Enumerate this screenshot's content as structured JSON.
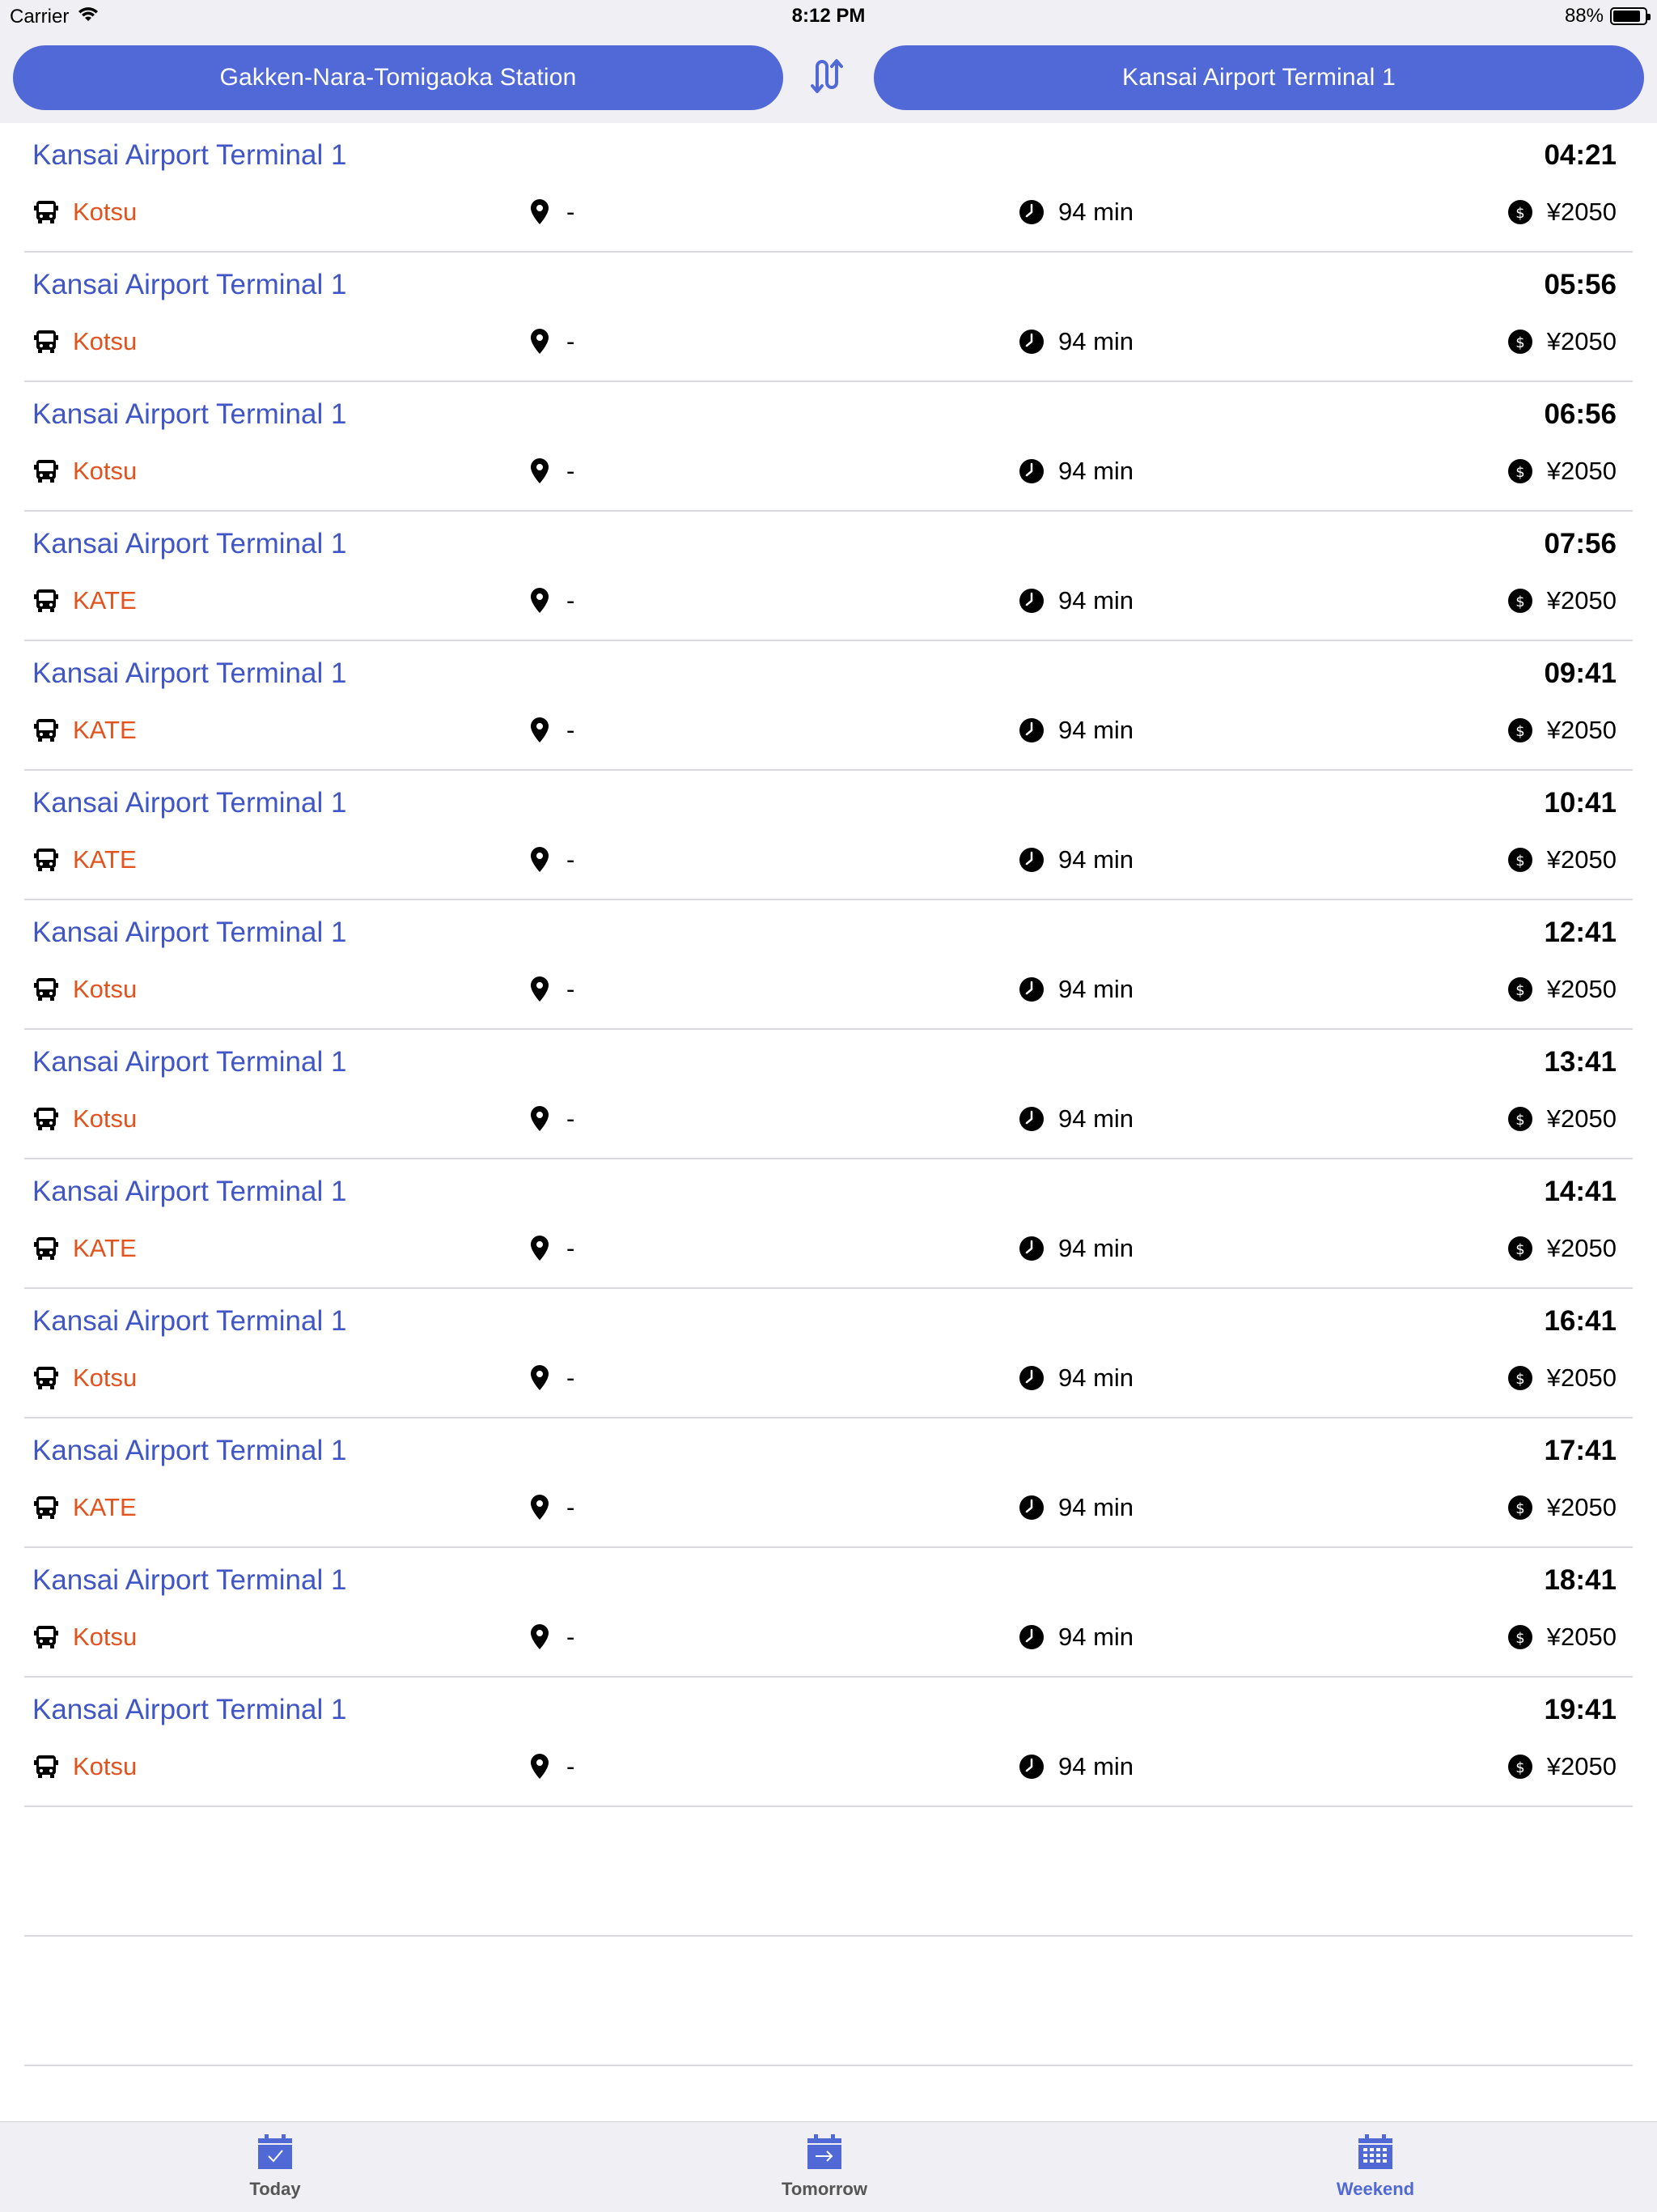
{
  "status_bar": {
    "carrier": "Carrier",
    "time": "8:12 PM",
    "battery": "88%"
  },
  "header": {
    "from_station": "Gakken-Nara-Tomigaoka Station",
    "to_station": "Kansai Airport Terminal 1"
  },
  "departures": [
    {
      "destination": "Kansai Airport Terminal 1",
      "time": "04:21",
      "operator": "Kotsu",
      "platform": "-",
      "duration": "94 min",
      "price": "¥2050"
    },
    {
      "destination": "Kansai Airport Terminal 1",
      "time": "05:56",
      "operator": "Kotsu",
      "platform": "-",
      "duration": "94 min",
      "price": "¥2050"
    },
    {
      "destination": "Kansai Airport Terminal 1",
      "time": "06:56",
      "operator": "Kotsu",
      "platform": "-",
      "duration": "94 min",
      "price": "¥2050"
    },
    {
      "destination": "Kansai Airport Terminal 1",
      "time": "07:56",
      "operator": "KATE",
      "platform": "-",
      "duration": "94 min",
      "price": "¥2050"
    },
    {
      "destination": "Kansai Airport Terminal 1",
      "time": "09:41",
      "operator": "KATE",
      "platform": "-",
      "duration": "94 min",
      "price": "¥2050"
    },
    {
      "destination": "Kansai Airport Terminal 1",
      "time": "10:41",
      "operator": "KATE",
      "platform": "-",
      "duration": "94 min",
      "price": "¥2050"
    },
    {
      "destination": "Kansai Airport Terminal 1",
      "time": "12:41",
      "operator": "Kotsu",
      "platform": "-",
      "duration": "94 min",
      "price": "¥2050"
    },
    {
      "destination": "Kansai Airport Terminal 1",
      "time": "13:41",
      "operator": "Kotsu",
      "platform": "-",
      "duration": "94 min",
      "price": "¥2050"
    },
    {
      "destination": "Kansai Airport Terminal 1",
      "time": "14:41",
      "operator": "KATE",
      "platform": "-",
      "duration": "94 min",
      "price": "¥2050"
    },
    {
      "destination": "Kansai Airport Terminal 1",
      "time": "16:41",
      "operator": "Kotsu",
      "platform": "-",
      "duration": "94 min",
      "price": "¥2050"
    },
    {
      "destination": "Kansai Airport Terminal 1",
      "time": "17:41",
      "operator": "KATE",
      "platform": "-",
      "duration": "94 min",
      "price": "¥2050"
    },
    {
      "destination": "Kansai Airport Terminal 1",
      "time": "18:41",
      "operator": "Kotsu",
      "platform": "-",
      "duration": "94 min",
      "price": "¥2050"
    },
    {
      "destination": "Kansai Airport Terminal 1",
      "time": "19:41",
      "operator": "Kotsu",
      "platform": "-",
      "duration": "94 min",
      "price": "¥2050"
    }
  ],
  "tabs": [
    {
      "label": "Today",
      "icon": "calendar-check-icon",
      "active": false
    },
    {
      "label": "Tomorrow",
      "icon": "calendar-arrow-icon",
      "active": false
    },
    {
      "label": "Weekend",
      "icon": "calendar-grid-icon",
      "active": true
    }
  ],
  "colors": {
    "accent": "#5169d6",
    "destination_text": "#4056c6",
    "operator_text": "#e2531d"
  }
}
